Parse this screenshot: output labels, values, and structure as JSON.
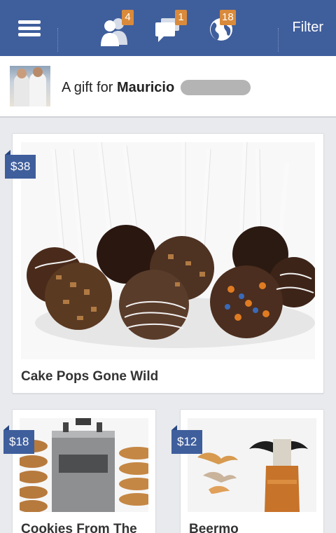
{
  "topbar": {
    "background": "#3f5e9c",
    "menu_icon": "hamburger-icon",
    "friends_badge": "4",
    "messages_badge": "1",
    "notifications_badge": "18",
    "filter_label": "Filter"
  },
  "gift": {
    "prefix": "A gift for ",
    "recipient": "Mauricio"
  },
  "products": [
    {
      "name": "Cake Pops Gone Wild",
      "price": "$38"
    },
    {
      "name": "Cookies From The",
      "price": "$18"
    },
    {
      "name": "Beermo",
      "price": "$12"
    }
  ]
}
